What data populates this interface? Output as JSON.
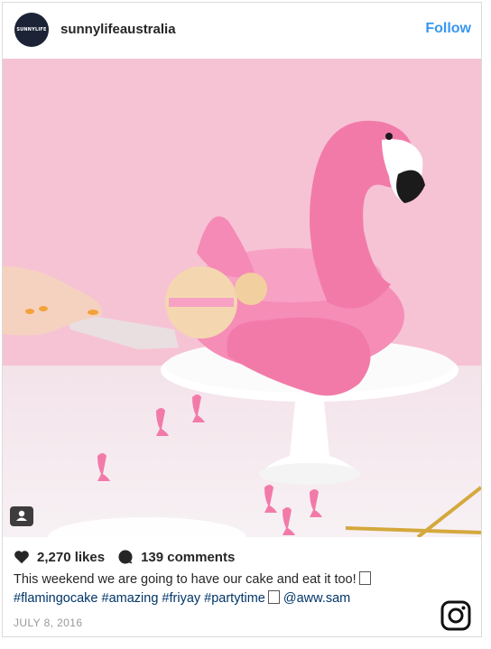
{
  "header": {
    "avatar_text": "SUNNYLIFE",
    "username": "sunnylifeaustralia",
    "follow_label": "Follow"
  },
  "photo": {
    "description_alt": "",
    "tag_icon": "user-tag-icon"
  },
  "stats": {
    "likes": "2,270 likes",
    "comments": "139 comments",
    "like_icon": "heart-icon",
    "comment_icon": "comment-bubble-icon"
  },
  "caption": {
    "text": "This weekend we are going to have our cake and eat it too!",
    "hashtags": "#flamingocake #amazing #friyay #partytime",
    "mention": "@aww.sam"
  },
  "date": "JULY 8, 2016",
  "brand_icon": "instagram-icon",
  "colors": {
    "link_blue": "#3897f0",
    "hashtag_blue": "#003569",
    "background_pink": "#f6c2d3",
    "flamingo_pink": "#f27aa9"
  }
}
